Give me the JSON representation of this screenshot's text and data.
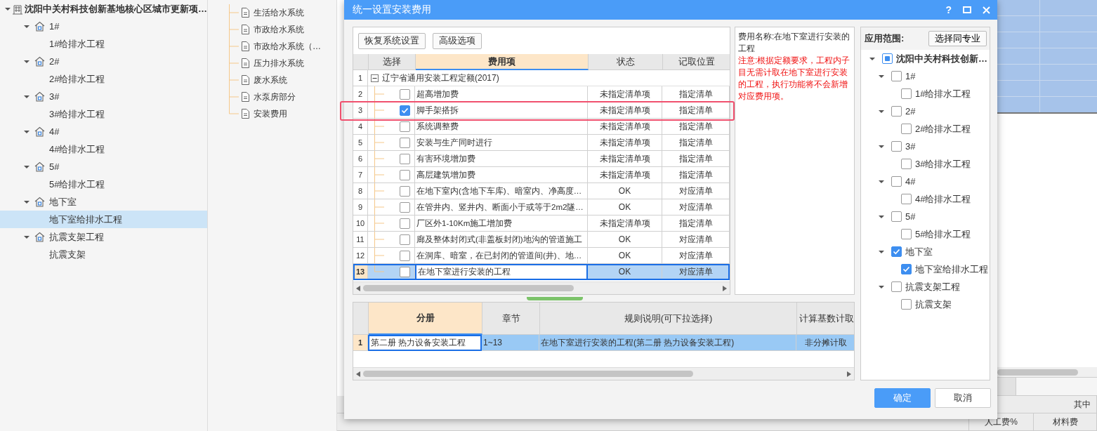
{
  "project_tree": [
    {
      "label": "沈阳中关村科技创新基地核心区城市更新项…",
      "kind": "project",
      "expanded": true,
      "selected": false,
      "children": [
        {
          "label": "1#",
          "kind": "unit",
          "expanded": true,
          "selected": false,
          "children": [
            {
              "label": "1#给排水工程",
              "selected": false
            }
          ]
        },
        {
          "label": "2#",
          "kind": "unit",
          "expanded": true,
          "selected": false,
          "children": [
            {
              "label": "2#给排水工程",
              "selected": false
            }
          ]
        },
        {
          "label": "3#",
          "kind": "unit",
          "expanded": true,
          "selected": false,
          "children": [
            {
              "label": "3#给排水工程",
              "selected": false
            }
          ]
        },
        {
          "label": "4#",
          "kind": "unit",
          "expanded": true,
          "selected": false,
          "children": [
            {
              "label": "4#给排水工程",
              "selected": false
            }
          ]
        },
        {
          "label": "5#",
          "kind": "unit",
          "expanded": true,
          "selected": false,
          "children": [
            {
              "label": "5#给排水工程",
              "selected": false
            }
          ]
        },
        {
          "label": "地下室",
          "kind": "unit",
          "expanded": true,
          "selected": false,
          "children": [
            {
              "label": "地下室给排水工程",
              "selected": true
            }
          ]
        },
        {
          "label": "抗震支架工程",
          "kind": "unit",
          "expanded": true,
          "selected": false,
          "children": [
            {
              "label": "抗震支架",
              "selected": false
            }
          ]
        }
      ]
    }
  ],
  "system_list": [
    "生活给水系统",
    "市政给水系统",
    "市政给水系统（…",
    "压力排水系统",
    "废水系统",
    "水泵房部分",
    "安装费用"
  ],
  "background_header": {
    "group": "其中",
    "columns": [
      "人工费%",
      "材料费"
    ]
  },
  "dialog": {
    "title": "统一设置安装费用",
    "help": "?",
    "toolbar": [
      "恢复系统设置",
      "高级选项"
    ],
    "fee_columns": [
      {
        "label": "选择",
        "selected": false
      },
      {
        "label": "费用项",
        "selected": true
      },
      {
        "label": "状态",
        "selected": false
      },
      {
        "label": "记取位置",
        "selected": false
      }
    ],
    "fee_rows": [
      {
        "number": "1",
        "kind": "group",
        "expanded": true,
        "name": "辽宁省通用安装工程定额(2017)",
        "selected": false
      },
      {
        "number": "2",
        "kind": "item",
        "checked": false,
        "name": "超高增加费",
        "status": "未指定清单项",
        "location": "指定清单",
        "selected": false
      },
      {
        "number": "3",
        "kind": "item",
        "checked": true,
        "name": "脚手架搭拆",
        "status": "未指定清单项",
        "location": "指定清单",
        "selected": false
      },
      {
        "number": "4",
        "kind": "item",
        "checked": false,
        "name": "系统调整费",
        "status": "未指定清单项",
        "location": "指定清单",
        "selected": false
      },
      {
        "number": "5",
        "kind": "item",
        "checked": false,
        "name": "安装与生产同时进行",
        "status": "未指定清单项",
        "location": "指定清单",
        "selected": false
      },
      {
        "number": "6",
        "kind": "item",
        "checked": false,
        "name": "有害环境增加费",
        "status": "未指定清单项",
        "location": "指定清单",
        "selected": false
      },
      {
        "number": "7",
        "kind": "item",
        "checked": false,
        "name": "高层建筑增加费",
        "status": "未指定清单项",
        "location": "指定清单",
        "selected": false
      },
      {
        "number": "8",
        "kind": "item",
        "checked": false,
        "name": "在地下室内(含地下车库)、暗室内、净高度…",
        "status": "OK",
        "location": "对应清单",
        "selected": false
      },
      {
        "number": "9",
        "kind": "item",
        "checked": false,
        "name": "在管井内、竖井内、断面小于或等于2m2隧…",
        "status": "OK",
        "location": "对应清单",
        "selected": false
      },
      {
        "number": "10",
        "kind": "item",
        "checked": false,
        "name": "厂区外1-10Km施工增加费",
        "status": "未指定清单项",
        "location": "指定清单",
        "selected": false
      },
      {
        "number": "11",
        "kind": "item",
        "checked": false,
        "name": "廊及整体封闭式(非盖板封闭)地沟的管道施工",
        "status": "OK",
        "location": "对应清单",
        "selected": false
      },
      {
        "number": "12",
        "kind": "item",
        "checked": false,
        "name": "在洞库、暗室，在已封闭的管道间(井)、地…",
        "status": "OK",
        "location": "对应清单",
        "selected": false
      },
      {
        "number": "13",
        "kind": "item",
        "checked": false,
        "name": "在地下室进行安装的工程",
        "status": "OK",
        "location": "对应清单",
        "selected": true
      }
    ],
    "description": {
      "name": "费用名称:在地下室进行安装的工程",
      "note": "注意:根据定额要求，工程内子目无需计取在地下室进行安装的工程，执行功能将不会新增对应费用项。"
    },
    "rule_columns": [
      {
        "label": "分册",
        "selected": true
      },
      {
        "label": "章节",
        "selected": false
      },
      {
        "label": "规则说明(可下拉选择)",
        "selected": false
      },
      {
        "label": "计算基数计取",
        "selected": false
      }
    ],
    "rule_rows": [
      {
        "number": "1",
        "cells": [
          "第二册 热力设备安装工程",
          "1~13",
          "在地下室进行安装的工程(第二册 热力设备安装工程)",
          "非分摊计取"
        ],
        "selected": true
      }
    ],
    "scope": {
      "title": "应用范围:",
      "button": "选择同专业",
      "tree": [
        {
          "label": "沈阳中关村科技创新…",
          "checked": false,
          "indeterminate": true,
          "expanded": true,
          "children": [
            {
              "label": "1#",
              "checked": false,
              "expanded": true,
              "children": [
                {
                  "label": "1#给排水工程",
                  "checked": false
                }
              ]
            },
            {
              "label": "2#",
              "checked": false,
              "expanded": true,
              "children": [
                {
                  "label": "2#给排水工程",
                  "checked": false
                }
              ]
            },
            {
              "label": "3#",
              "checked": false,
              "expanded": true,
              "children": [
                {
                  "label": "3#给排水工程",
                  "checked": false
                }
              ]
            },
            {
              "label": "4#",
              "checked": false,
              "expanded": true,
              "children": [
                {
                  "label": "4#给排水工程",
                  "checked": false
                }
              ]
            },
            {
              "label": "5#",
              "checked": false,
              "expanded": true,
              "children": [
                {
                  "label": "5#给排水工程",
                  "checked": false
                }
              ]
            },
            {
              "label": "地下室",
              "checked": true,
              "expanded": true,
              "children": [
                {
                  "label": "地下室给排水工程",
                  "checked": true
                }
              ]
            },
            {
              "label": "抗震支架工程",
              "checked": false,
              "expanded": true,
              "children": [
                {
                  "label": "抗震支架",
                  "checked": false
                }
              ]
            }
          ]
        }
      ]
    },
    "buttons": [
      {
        "label": "确定",
        "kind": "primary"
      },
      {
        "label": "取消",
        "kind": "default"
      }
    ]
  }
}
